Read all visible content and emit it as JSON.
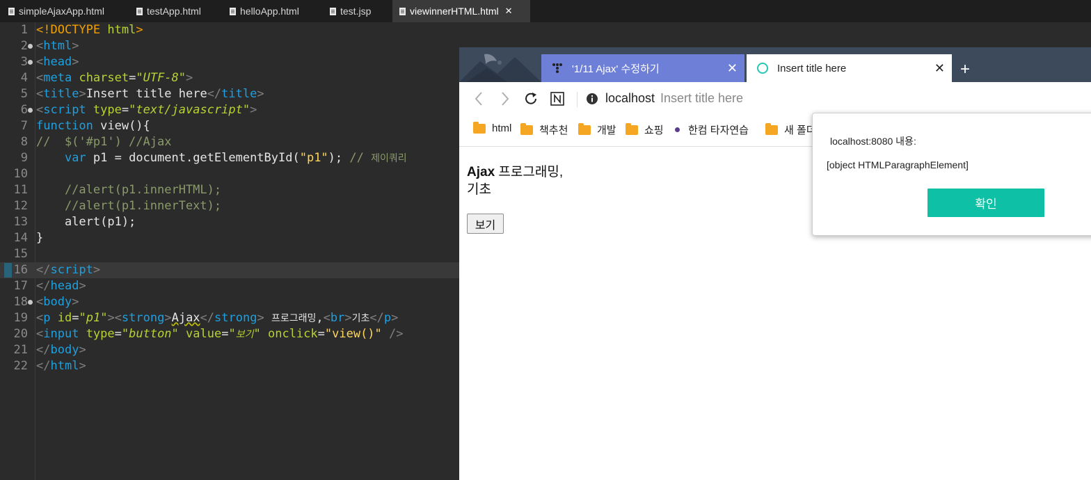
{
  "editor_tabs": [
    {
      "label": "simpleAjaxApp.html",
      "active": false
    },
    {
      "label": "testApp.html",
      "active": false
    },
    {
      "label": "helloApp.html",
      "active": false
    },
    {
      "label": "test.jsp",
      "active": false
    },
    {
      "label": "viewinnerHTML.html",
      "active": true,
      "close": "✕"
    }
  ],
  "code": {
    "line_numbers": [
      "1",
      "2",
      "3",
      "4",
      "5",
      "6",
      "7",
      "8",
      "9",
      "10",
      "11",
      "12",
      "13",
      "14",
      "15",
      "16",
      "17",
      "18",
      "19",
      "20",
      "21",
      "22"
    ],
    "current_line": "16"
  },
  "browser": {
    "tabs": [
      {
        "label": "'1/11 Ajax' 수정하기",
        "close": "✕"
      },
      {
        "label": "Insert title here",
        "close": "✕"
      }
    ],
    "new_tab": "+",
    "address": {
      "host": "localhost",
      "title": "Insert title here"
    },
    "bookmarks": [
      {
        "label": "html",
        "icon": "folder-icon"
      },
      {
        "label": "책추천",
        "icon": "folder-icon"
      },
      {
        "label": "개발",
        "icon": "folder-icon"
      },
      {
        "label": "쇼핑",
        "icon": "folder-icon"
      },
      {
        "label": "한컴 타자연습",
        "icon": "dot-icon"
      },
      {
        "label": "새 폴더",
        "icon": "folder-icon"
      }
    ],
    "page": {
      "strong": "Ajax",
      "text1": " 프로그래밍,",
      "text2": "기초",
      "button": "보기"
    }
  },
  "dialog": {
    "title": "localhost:8080 내용:",
    "message": "[object HTMLParagraphElement]",
    "ok": "확인"
  },
  "colors": {
    "editor_bg": "#2b2b2b",
    "tag": "#1ea0e0",
    "attr": "#b9d232",
    "string": "#ffd65c",
    "comment": "#8a9a6a",
    "browser_tab_active_other": "#6e7fd8",
    "dialog_button": "#0ec0a5"
  }
}
